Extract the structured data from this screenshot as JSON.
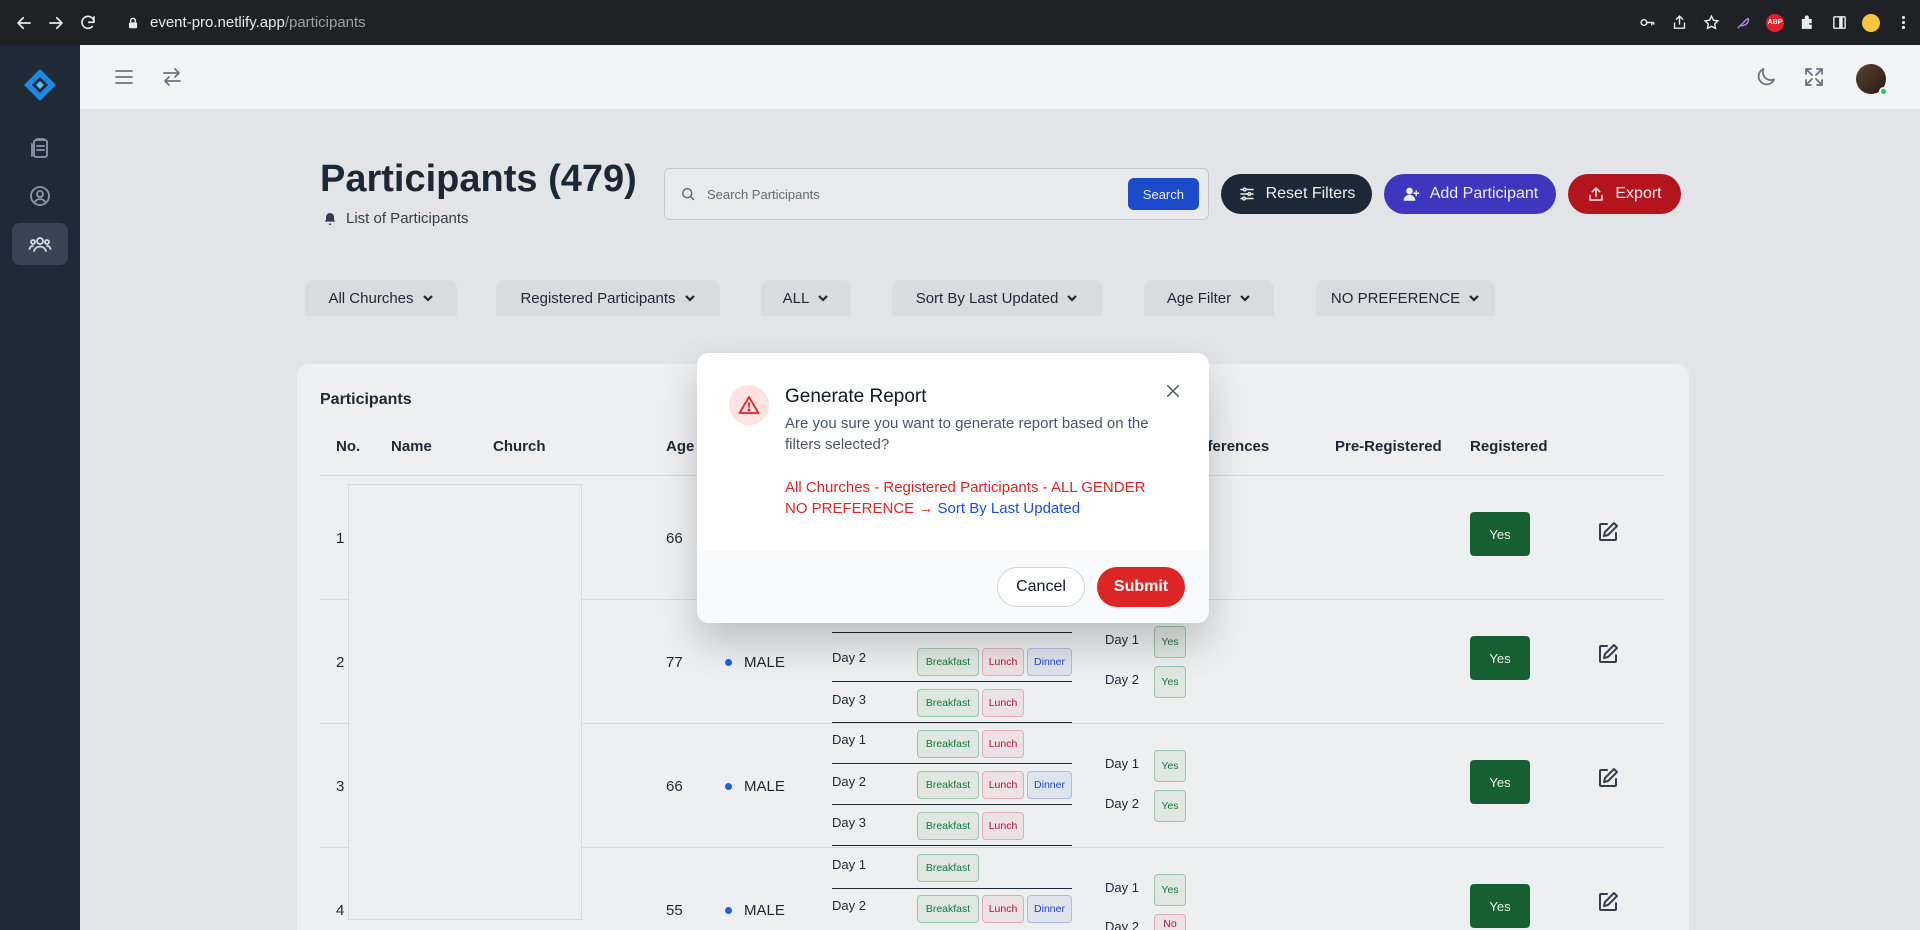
{
  "browser": {
    "url_domain": "event-pro.netlify.app",
    "url_path": "/participants"
  },
  "header": {
    "title": "Participants (479)",
    "subtitle": "List of Participants"
  },
  "search": {
    "placeholder": "Search Participants",
    "button_label": "Search"
  },
  "actions": {
    "reset": "Reset Filters",
    "add": "Add Participant",
    "export": "Export"
  },
  "filters": [
    "All Churches",
    "Registered Participants",
    "ALL",
    "Sort By Last Updated",
    "Age Filter",
    "NO PREFERENCE"
  ],
  "table": {
    "title": "Participants",
    "columns": [
      "No.",
      "Name",
      "Church",
      "Age",
      "n Preferences",
      "Pre-Registered",
      "Registered"
    ],
    "rows": [
      {
        "no": "1",
        "age": "66",
        "registered": "Yes"
      },
      {
        "no": "2",
        "age": "77",
        "gender": "MALE",
        "registered": "Yes"
      },
      {
        "no": "3",
        "age": "66",
        "gender": "MALE",
        "registered": "Yes"
      },
      {
        "no": "4",
        "age": "55",
        "gender": "MALE",
        "registered": "Yes"
      }
    ],
    "meals": {
      "day1": "Day 1",
      "day2": "Day 2",
      "day3": "Day 3",
      "breakfast": "Breakfast",
      "lunch": "Lunch",
      "dinner": "Dinner",
      "yes": "Yes",
      "no": "No"
    }
  },
  "modal": {
    "title": "Generate Report",
    "message": "Are you sure you want to generate report based on the filters selected?",
    "filters_line1": "All Churches - Registered Participants - ALL GENDER",
    "filters_line2": "NO PREFERENCE →",
    "sort": "Sort By Last Updated",
    "cancel": "Cancel",
    "submit": "Submit"
  },
  "colors": {
    "primary": "#1d4ed8",
    "danger": "#dc2626",
    "dark": "#1f2937",
    "indigo": "#4338ca",
    "success": "#166534",
    "sidebar": "#202a36"
  }
}
